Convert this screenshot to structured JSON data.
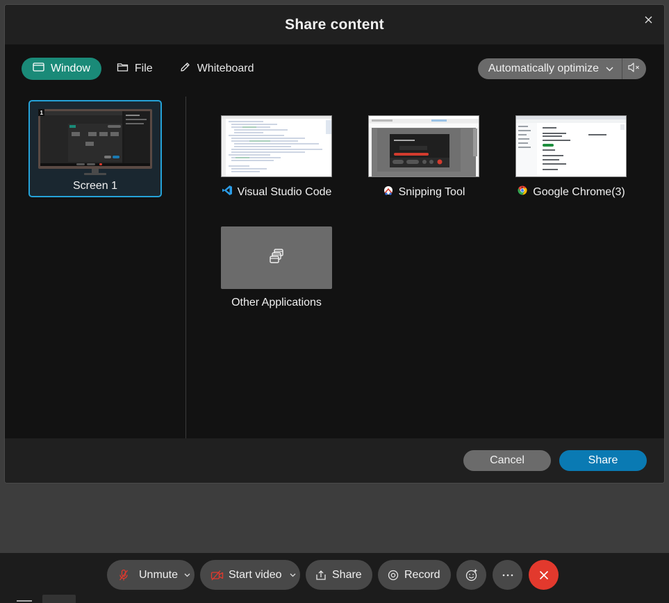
{
  "dialog": {
    "title": "Share content",
    "tabs": [
      {
        "label": "Window",
        "icon": "window-icon",
        "active": true
      },
      {
        "label": "File",
        "icon": "folder-icon",
        "active": false
      },
      {
        "label": "Whiteboard",
        "icon": "pencil-icon",
        "active": false
      }
    ],
    "optimize": {
      "selected": "Automatically optimize"
    },
    "screens": [
      {
        "label": "Screen 1",
        "number": "1",
        "selected": true
      }
    ],
    "apps": [
      {
        "label": "Visual Studio Code",
        "icon": "vscode-icon"
      },
      {
        "label": "Snipping Tool",
        "icon": "snipping-tool-icon"
      },
      {
        "label": "Google Chrome(3)",
        "icon": "chrome-icon"
      },
      {
        "label": "Other Applications",
        "icon": "other-apps-icon"
      }
    ],
    "footer": {
      "cancel": "Cancel",
      "share": "Share"
    }
  },
  "meeting_bar": {
    "unmute": "Unmute",
    "start_video": "Start video",
    "share": "Share",
    "record": "Record"
  },
  "colors": {
    "accent_tab": "#1a8a78",
    "share_button": "#0a7ab3",
    "selection_border": "#25a3d9",
    "end_call": "#e2392d",
    "muted_red": "#e2392d"
  }
}
